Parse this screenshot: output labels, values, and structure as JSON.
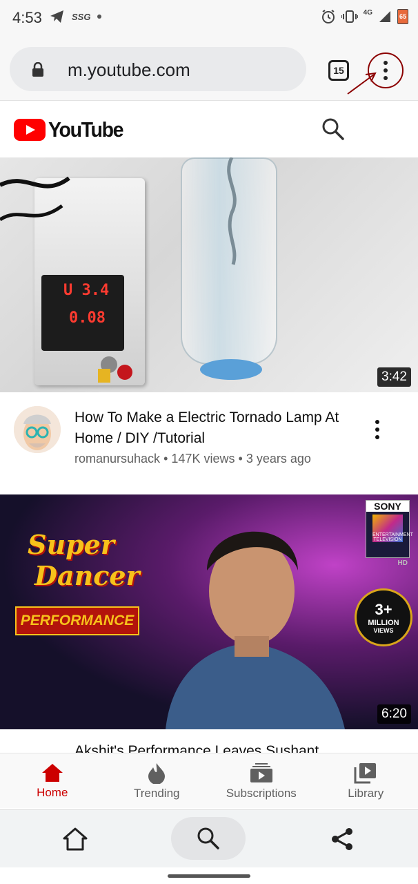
{
  "status": {
    "time": "4:53",
    "left_icons": [
      "telegram-icon",
      "ssg-icon"
    ],
    "ssg_text": "SSG",
    "right_icons": [
      "alarm-icon",
      "vibrate-icon",
      "signal-icon",
      "battery-icon"
    ],
    "network": "4G",
    "battery": "65"
  },
  "browser": {
    "url": "m.youtube.com",
    "tab_count": "15"
  },
  "youtube": {
    "logo_text": "YouTube"
  },
  "videos": [
    {
      "duration": "3:42",
      "title": "How To Make a Electric Tornado Lamp At Home / DIY /Tutorial",
      "channel": "romanursuhack",
      "views": "147K views",
      "age": "3 years ago",
      "separator": "•",
      "thumb_text": [
        "U 3.4",
        "0.08"
      ]
    },
    {
      "duration": "6:20",
      "thumb_text": [
        "Super",
        "Dancer",
        "PERFORMANCE",
        "SONY",
        "ENTERTAINMENT TELEVISION",
        "HD",
        "3+",
        "MILLION",
        "VIEWS"
      ],
      "title_partial": "Akshit's Performance Leaves Sushant"
    }
  ],
  "nav": {
    "items": [
      {
        "label": "Home",
        "icon": "home-icon",
        "active": true
      },
      {
        "label": "Trending",
        "icon": "trending-icon",
        "active": false
      },
      {
        "label": "Subscriptions",
        "icon": "subscriptions-icon",
        "active": false
      },
      {
        "label": "Library",
        "icon": "library-icon",
        "active": false
      }
    ]
  },
  "colors": {
    "brand_red": "#ff0000",
    "active_red": "#cc0000",
    "annotation_red": "#8b0000"
  }
}
